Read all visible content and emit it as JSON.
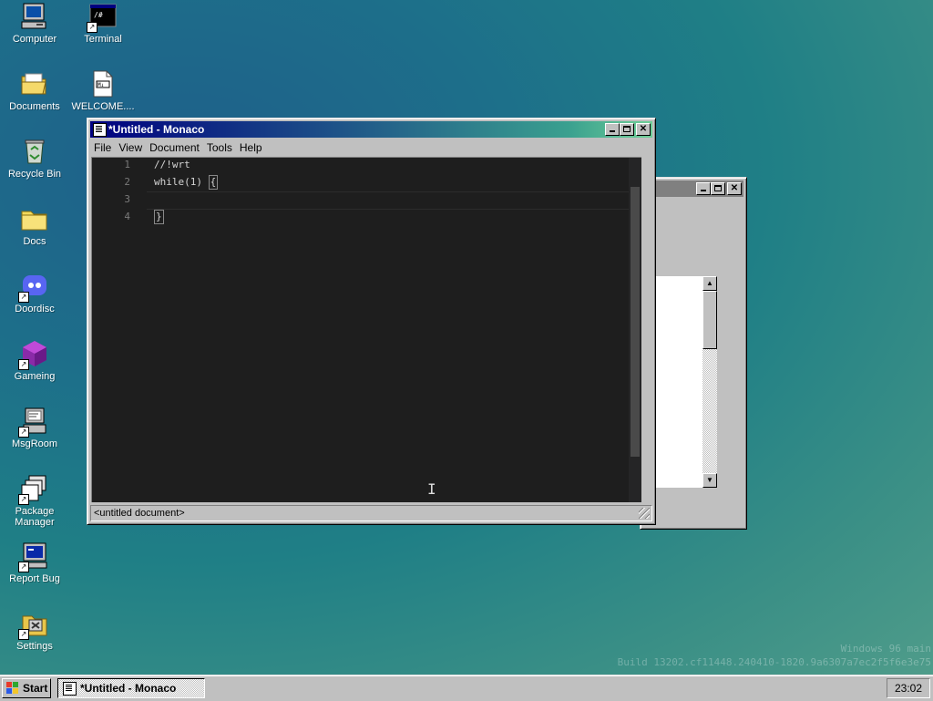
{
  "desktop": {
    "icons": [
      {
        "label": "Computer"
      },
      {
        "label": "Terminal"
      },
      {
        "label": "Documents"
      },
      {
        "label": "WELCOME...."
      },
      {
        "label": "Recycle Bin"
      },
      {
        "label": "Docs"
      },
      {
        "label": "Doordisc"
      },
      {
        "label": "Gameing"
      },
      {
        "label": "MsgRoom"
      },
      {
        "label": "Package Manager"
      },
      {
        "label": "Report Bug"
      },
      {
        "label": "Settings"
      }
    ],
    "watermark": {
      "line1": "Windows 96 main",
      "line2": "Build 13202.cf11448.240410-1820.9a6307a7ec2f5f6e3e75"
    }
  },
  "editor_window": {
    "title": "*Untitled - Monaco",
    "menu": [
      "File",
      "View",
      "Document",
      "Tools",
      "Help"
    ],
    "line_numbers": [
      "1",
      "2",
      "3",
      "4"
    ],
    "code_lines": [
      "//!wrt",
      "while(1) ",
      "",
      ""
    ],
    "brace_open": "{",
    "brace_close": "}",
    "status": "<untitled document>"
  },
  "background_window": {
    "scroll_up": "▲",
    "scroll_down": "▼"
  },
  "taskbar": {
    "start_label": "Start",
    "task_label": "*Untitled - Monaco",
    "clock": "23:02"
  },
  "colors": {
    "titlebar_active_start": "#000080",
    "titlebar_active_end": "#6fcf97",
    "editor_bg": "#1e1e1e",
    "chrome": "#c0c0c0"
  }
}
